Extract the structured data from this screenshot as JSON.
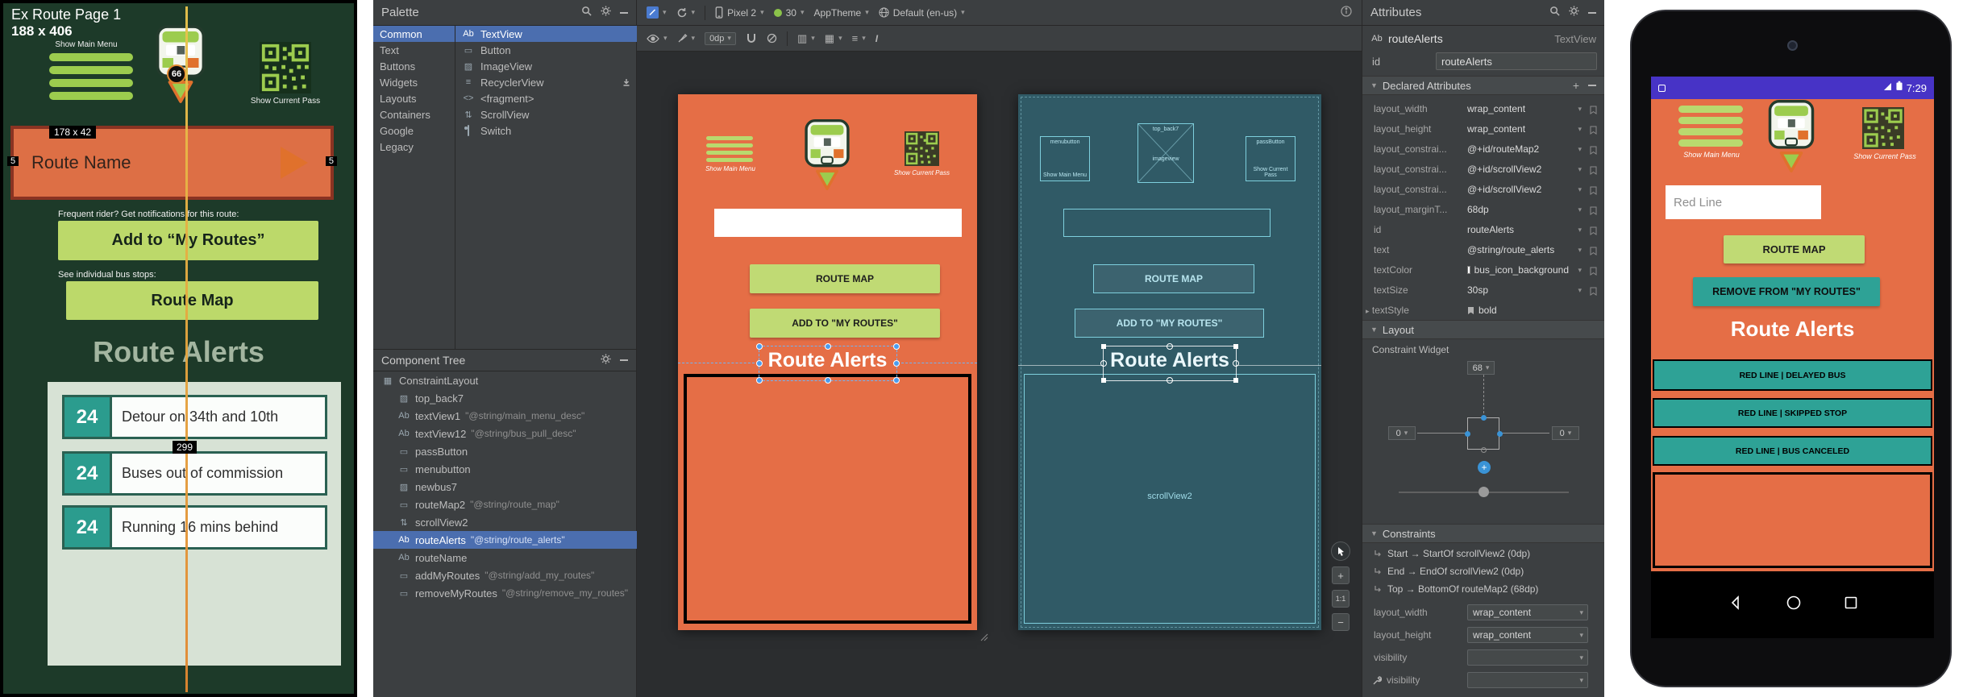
{
  "colors": {
    "orange": "#e56e46",
    "green_light": "#c0da74",
    "teal": "#2ea296",
    "blueprint_bg": "#305a66",
    "selection_blue": "#4b6eaf",
    "statusbar_purple": "#4733c6",
    "mockup_bg": "#1d3a29"
  },
  "mockup": {
    "page_title": "Ex Route Page 1",
    "size_label": "188 x 406",
    "menu_label": "Show Main Menu",
    "bus_badge": "66",
    "pass_label": "Show Current Pass",
    "route_box": {
      "size_label": "178 x 42",
      "name": "Route Name",
      "margin_left": "5",
      "margin_right": "5"
    },
    "notify_caption": "Frequent rider? Get notifications for this route:",
    "add_button": "Add to “My Routes”",
    "stops_caption": "See individual bus stops:",
    "map_button": "Route Map",
    "alerts_title": "Route Alerts",
    "height_label": "299",
    "alerts": [
      {
        "badge": "24",
        "text": "Detour on 34th and 10th"
      },
      {
        "badge": "24",
        "text": "Buses out of commission"
      },
      {
        "badge": "24",
        "text": "Running 16 mins behind"
      }
    ]
  },
  "icons": {
    "textview": "Ab",
    "fragment": "<>",
    "button": "▭",
    "image": "▨",
    "recycler": "≡",
    "scroll": "⇅",
    "layout": "▦"
  },
  "panels": {
    "palette": "Palette",
    "tree": "Component Tree",
    "attributes": "Attributes"
  },
  "palette": {
    "categories": [
      {
        "label": "Common"
      },
      {
        "label": "Text"
      },
      {
        "label": "Buttons"
      },
      {
        "label": "Widgets"
      },
      {
        "label": "Layouts"
      },
      {
        "label": "Containers"
      },
      {
        "label": "Google"
      },
      {
        "label": "Legacy"
      }
    ],
    "items": [
      {
        "label": "TextView"
      },
      {
        "label": "Button"
      },
      {
        "label": "ImageView"
      },
      {
        "label": "RecyclerView"
      },
      {
        "label": "<fragment>"
      },
      {
        "label": "ScrollView"
      },
      {
        "label": "Switch"
      }
    ]
  },
  "component_tree": {
    "items": [
      {
        "label": "ConstraintLayout",
        "note": ""
      },
      {
        "label": "top_back7",
        "note": ""
      },
      {
        "label": "textView1",
        "note": "\"@string/main_menu_desc\""
      },
      {
        "label": "textView12",
        "note": "\"@string/bus_pull_desc\""
      },
      {
        "label": "passButton",
        "note": ""
      },
      {
        "label": "menubutton",
        "note": ""
      },
      {
        "label": "newbus7",
        "note": ""
      },
      {
        "label": "routeMap2",
        "note": "\"@string/route_map\""
      },
      {
        "label": "scrollView2",
        "note": ""
      },
      {
        "label": "routeAlerts",
        "note": "\"@string/route_alerts\""
      },
      {
        "label": "routeName",
        "note": ""
      },
      {
        "label": "addMyRoutes",
        "note": "\"@string/add_my_routes\""
      },
      {
        "label": "removeMyRoutes",
        "note": "\"@string/remove_my_routes\""
      }
    ]
  },
  "toolbar": {
    "device": "Pixel 2",
    "api": "30",
    "theme": "AppTheme",
    "locale": "Default (en-us)",
    "margin": "0dp"
  },
  "surface": {
    "zoom_in": "+",
    "zoom_fit": "1:1",
    "zoom_out": "−"
  },
  "design": {
    "menu_label": "Show Main Menu",
    "pass_label": "Show Current Pass",
    "route_map": "ROUTE MAP",
    "add_routes": "ADD TO \"MY ROUTES\"",
    "alerts_title": "Route Alerts"
  },
  "blueprint": {
    "menubutton": "menubutton",
    "menu_desc": "Show Main Menu",
    "top_back": "top_back7",
    "imageview": "imageview",
    "passbutton": "passButton",
    "pass_desc": "Show Current Pass",
    "route_map": "ROUTE MAP",
    "add_routes": "ADD TO \"MY ROUTES\"",
    "alerts_title": "Route Alerts",
    "scrollview": "scrollView2"
  },
  "attributes": {
    "component": "routeAlerts",
    "component_type": "TextView",
    "id_label": "id",
    "id_value": "routeAlerts",
    "declared_section": "Declared Attributes",
    "rows": [
      {
        "name": "layout_width",
        "value": "wrap_content"
      },
      {
        "name": "layout_height",
        "value": "wrap_content"
      },
      {
        "name": "layout_constrai...",
        "value": "@+id/routeMap2"
      },
      {
        "name": "layout_constrai...",
        "value": "@+id/scrollView2"
      },
      {
        "name": "layout_constrai...",
        "value": "@+id/scrollView2"
      },
      {
        "name": "layout_marginT...",
        "value": "68dp"
      },
      {
        "name": "id",
        "value": "routeAlerts"
      },
      {
        "name": "text",
        "value": "@string/route_alerts"
      },
      {
        "name": "textColor",
        "value": "bus_icon_background"
      },
      {
        "name": "textSize",
        "value": "30sp"
      },
      {
        "name": "textStyle",
        "value": "bold"
      }
    ],
    "layout_section": "Layout",
    "constraint_widget_label": "Constraint Widget",
    "widget": {
      "top_margin": "68",
      "left_margin": "0",
      "right_margin": "0"
    },
    "constraints_section": "Constraints",
    "constraints": [
      "Start → StartOf scrollView2 (0dp)",
      "End → EndOf scrollView2 (0dp)",
      "Top → BottomOf routeMap2 (68dp)"
    ],
    "bottom_rows": [
      {
        "name": "layout_width",
        "value": "wrap_content"
      },
      {
        "name": "layout_height",
        "value": "wrap_content"
      },
      {
        "name": "visibility",
        "value": ""
      },
      {
        "name": "visibility",
        "value": ""
      }
    ]
  },
  "emulator": {
    "time": "7:29",
    "menu_label": "Show Main Menu",
    "pass_label": "Show Current Pass",
    "route_name": "Red Line",
    "route_map": "ROUTE MAP",
    "remove_routes": "REMOVE FROM \"MY ROUTES\"",
    "alerts_title": "Route Alerts",
    "alerts": [
      "RED LINE | DELAYED BUS",
      "RED LINE | SKIPPED STOP",
      "RED LINE | BUS CANCELED"
    ]
  }
}
